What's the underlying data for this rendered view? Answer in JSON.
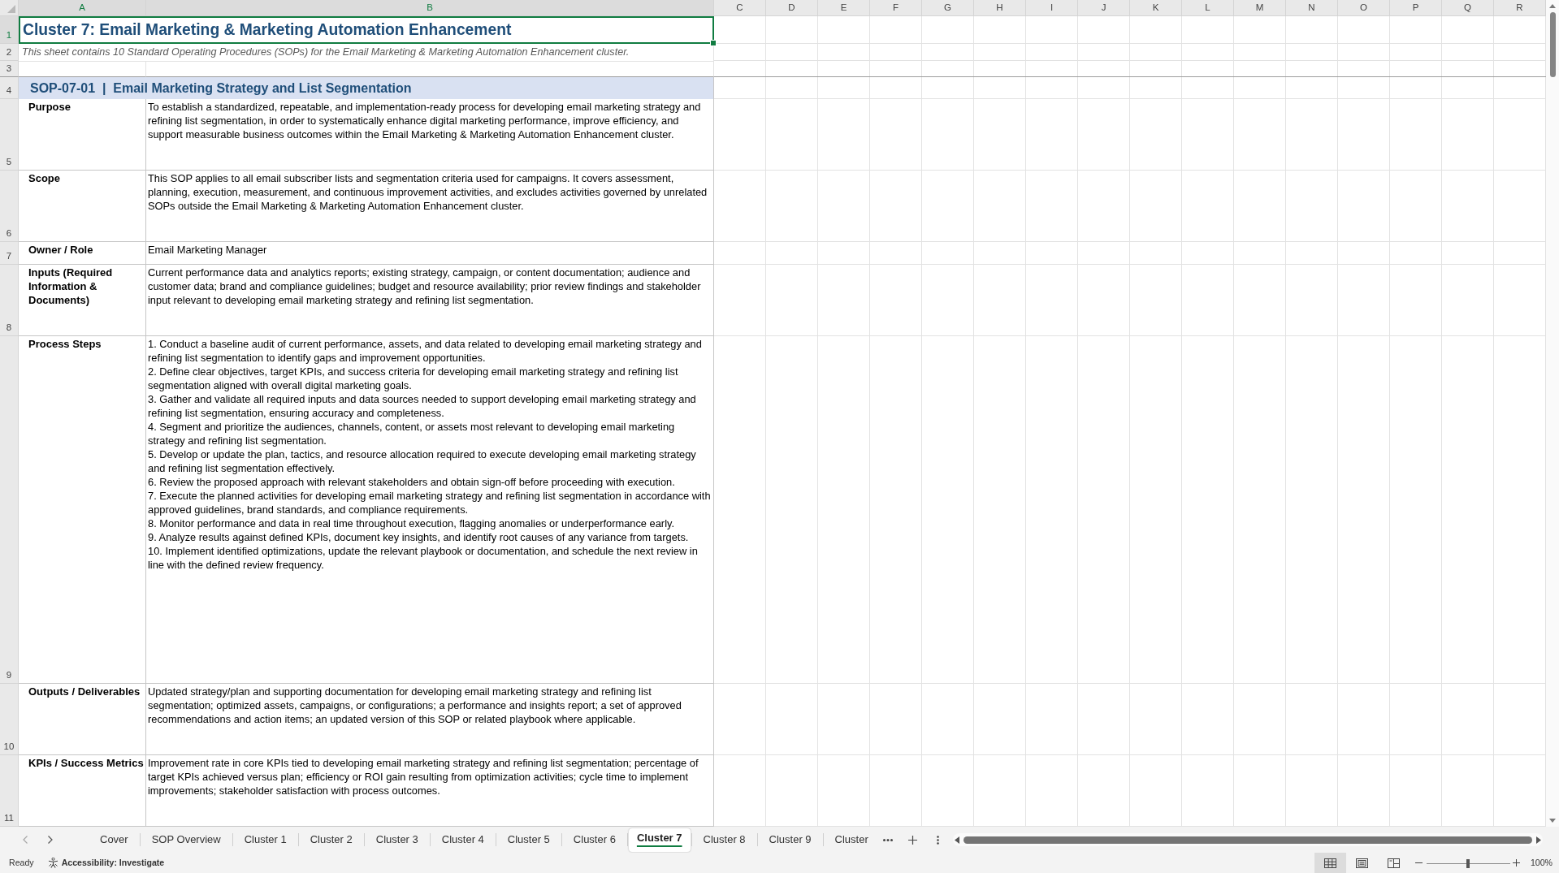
{
  "columns": [
    {
      "label": "A",
      "selected": true
    },
    {
      "label": "B",
      "selected": true
    },
    {
      "label": "C",
      "selected": false
    },
    {
      "label": "D",
      "selected": false
    },
    {
      "label": "E",
      "selected": false
    },
    {
      "label": "F",
      "selected": false
    },
    {
      "label": "G",
      "selected": false
    },
    {
      "label": "H",
      "selected": false
    },
    {
      "label": "I",
      "selected": false
    },
    {
      "label": "J",
      "selected": false
    },
    {
      "label": "K",
      "selected": false
    },
    {
      "label": "L",
      "selected": false
    },
    {
      "label": "M",
      "selected": false
    },
    {
      "label": "N",
      "selected": false
    },
    {
      "label": "O",
      "selected": false
    },
    {
      "label": "P",
      "selected": false
    },
    {
      "label": "Q",
      "selected": false
    },
    {
      "label": "R",
      "selected": false
    }
  ],
  "rows": [
    {
      "label": "1",
      "selected": true
    },
    {
      "label": "2",
      "selected": false
    },
    {
      "label": "3",
      "selected": false
    },
    {
      "label": "4",
      "selected": false
    },
    {
      "label": "5",
      "selected": false
    },
    {
      "label": "6",
      "selected": false
    },
    {
      "label": "7",
      "selected": false
    },
    {
      "label": "8",
      "selected": false
    },
    {
      "label": "9",
      "selected": false
    },
    {
      "label": "10",
      "selected": false
    },
    {
      "label": "11",
      "selected": false
    }
  ],
  "title": {
    "text": "Cluster 7: Email Marketing & Marketing Automation Enhancement",
    "selected": true
  },
  "description": "This sheet contains 10 Standard Operating Procedures (SOPs) for the Email Marketing & Marketing Automation Enhancement cluster.",
  "sop": {
    "header": "SOP-07-01  |  Email Marketing Strategy and List Segmentation",
    "fields": [
      {
        "kind": "text",
        "label": "Purpose",
        "text": "To establish a standardized, repeatable, and implementation-ready process for developing email marketing strategy and refining list segmentation, in order to systematically enhance digital marketing performance, improve efficiency, and support measurable business outcomes within the Email Marketing & Marketing Automation Enhancement cluster."
      },
      {
        "kind": "text",
        "label": "Scope",
        "text": "This SOP applies to all email subscriber lists and segmentation criteria used for campaigns. It covers assessment, planning, execution, measurement, and continuous improvement activities, and excludes activities governed by unrelated SOPs outside the Email Marketing & Marketing Automation Enhancement cluster."
      },
      {
        "kind": "text",
        "label": "Owner / Role",
        "text": "Email Marketing Manager"
      },
      {
        "kind": "text",
        "label": "Inputs (Required Information & Documents)",
        "text": "Current performance data and analytics reports; existing strategy, campaign, or content documentation; audience and customer data; brand and compliance guidelines; budget and resource availability; prior review findings and stakeholder input relevant to developing email marketing strategy and refining list segmentation."
      },
      {
        "kind": "steps",
        "label": "Process Steps",
        "steps": [
          "1. Conduct a baseline audit of current performance, assets, and data related to developing email marketing strategy and refining list segmentation to identify gaps and improvement opportunities.",
          "2. Define clear objectives, target KPIs, and success criteria for developing email marketing strategy and refining list segmentation aligned with overall digital marketing goals.",
          "3. Gather and validate all required inputs and data sources needed to support developing email marketing strategy and refining list segmentation, ensuring accuracy and completeness.",
          "4. Segment and prioritize the audiences, channels, content, or assets most relevant to developing email marketing strategy and refining list segmentation.",
          "5. Develop or update the plan, tactics, and resource allocation required to execute developing email marketing strategy and refining list segmentation effectively.",
          "6. Review the proposed approach with relevant stakeholders and obtain sign-off before proceeding with execution.",
          "7. Execute the planned activities for developing email marketing strategy and refining list segmentation in accordance with approved guidelines, brand standards, and compliance requirements.",
          "8. Monitor performance and data in real time throughout execution, flagging anomalies or underperformance early.",
          "9. Analyze results against defined KPIs, document key insights, and identify root causes of any variance from targets.",
          "10. Implement identified optimizations, update the relevant playbook or documentation, and schedule the next review in line with the defined review frequency."
        ]
      },
      {
        "kind": "text",
        "label": "Outputs / Deliverables",
        "text": "Updated strategy/plan and supporting documentation for developing email marketing strategy and refining list segmentation; optimized assets, campaigns, or configurations; a performance and insights report; a set of approved recommendations and action items; an updated version of this SOP or related playbook where applicable."
      },
      {
        "kind": "text",
        "label": "KPIs / Success Metrics",
        "text": "Improvement rate in core KPIs tied to developing email marketing strategy and refining list segmentation; percentage of target KPIs achieved versus plan; efficiency or ROI gain resulting from optimization activities; cycle time to implement improvements; stakeholder satisfaction with process outcomes."
      }
    ]
  },
  "sheet_tabs": [
    {
      "label": "Cover",
      "selected": false
    },
    {
      "label": "SOP Overview",
      "selected": false
    },
    {
      "label": "Cluster 1",
      "selected": false
    },
    {
      "label": "Cluster 2",
      "selected": false
    },
    {
      "label": "Cluster 3",
      "selected": false
    },
    {
      "label": "Cluster 4",
      "selected": false
    },
    {
      "label": "Cluster 5",
      "selected": false
    },
    {
      "label": "Cluster 6",
      "selected": false
    },
    {
      "label": "Cluster 7",
      "selected": true
    },
    {
      "label": "Cluster 8",
      "selected": false
    },
    {
      "label": "Cluster 9",
      "selected": false
    },
    {
      "label": "Cluster",
      "selected": false
    }
  ],
  "status_bar": {
    "mode": "Ready",
    "accessibility": "Accessibility: Investigate",
    "views": [
      {
        "kind": "normal",
        "selected": true
      },
      {
        "kind": "page_layout",
        "selected": false
      },
      {
        "kind": "page_break_preview",
        "selected": false
      }
    ],
    "zoom_slider": {
      "level": 0.5
    },
    "zoom": "100%"
  }
}
